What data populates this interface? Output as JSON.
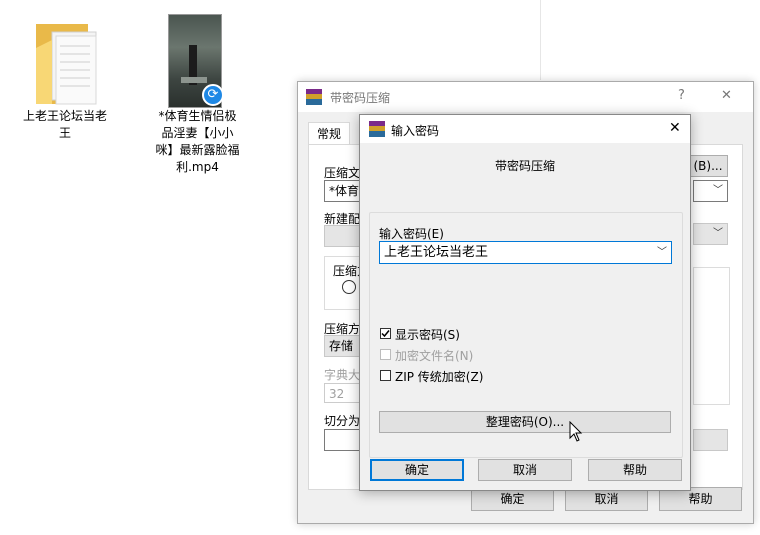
{
  "desktop": {
    "folder_label": "上老王论坛当老\n王",
    "video_label": "*体育生情侣极\n品淫妻【小小\n咪】最新露脸福\n利.mp4"
  },
  "back_dialog": {
    "title": "带密码压缩",
    "help_glyph": "?",
    "close_glyph": "✕",
    "tab_general": "常规",
    "label_compress_file": "压缩文",
    "file_value": "*体育",
    "browse_button": "(B)...",
    "label_new_config": "新建配",
    "label_compress_format": "压缩方",
    "label_compression_method": "压缩方",
    "method_value": "存储",
    "label_dictionary": "字典大",
    "dictionary_value": "32",
    "label_split": "切分为",
    "ok_button": "确定",
    "cancel_button": "取消",
    "help_button": "帮助"
  },
  "front_dialog": {
    "title": "输入密码",
    "close_glyph": "✕",
    "heading": "带密码压缩",
    "password_label": "输入密码(E)",
    "password_value": "上老王论坛当老王",
    "show_password_label": "显示密码(S)",
    "show_password_checked": true,
    "encrypt_names_label": "加密文件名(N)",
    "encrypt_names_checked": false,
    "zip_legacy_label": "ZIP 传统加密(Z)",
    "zip_legacy_checked": false,
    "organize_button": "整理密码(O)...",
    "ok_button": "确定",
    "cancel_button": "取消",
    "help_button": "帮助"
  },
  "colors": {
    "dialog_bg": "#f0f0f0",
    "accent": "#0078d7",
    "folder_yellow": "#f8d775"
  }
}
